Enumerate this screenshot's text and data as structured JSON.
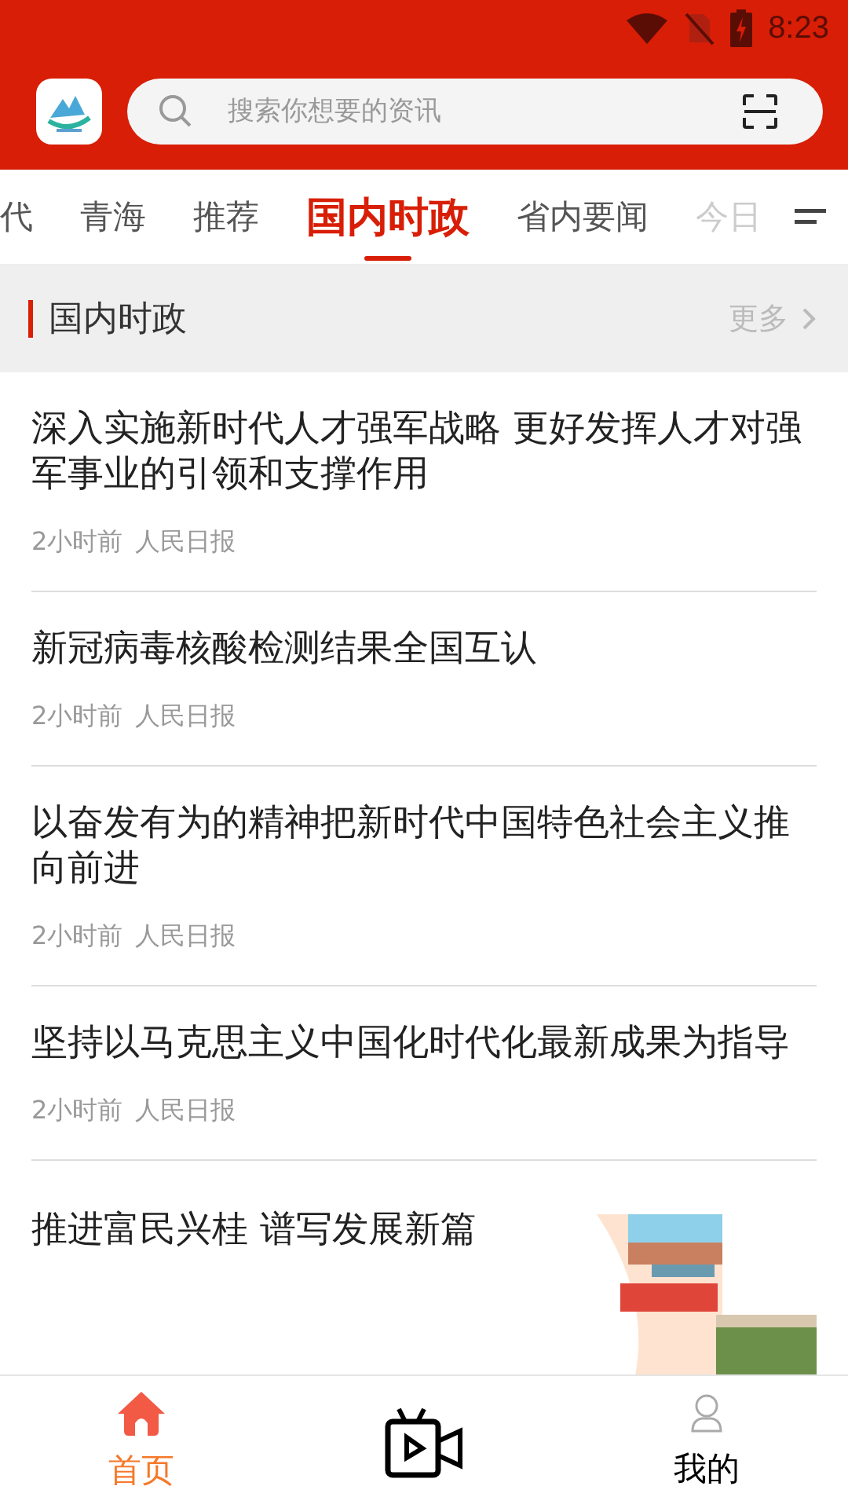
{
  "status_bar": {
    "time": "8:23"
  },
  "search": {
    "placeholder": "搜索你想要的资讯"
  },
  "tabs": [
    {
      "label": "代",
      "selected": false
    },
    {
      "label": "青海",
      "selected": false
    },
    {
      "label": "推荐",
      "selected": false
    },
    {
      "label": "国内时政",
      "selected": true
    },
    {
      "label": "省内要闻",
      "selected": false
    },
    {
      "label": "今日",
      "selected": false
    }
  ],
  "section": {
    "title": "国内时政",
    "more": "更多"
  },
  "articles": [
    {
      "title": "深入实施新时代人才强军战略  更好发挥人才对强军事业的引领和支撑作用",
      "time": "2小时前",
      "source": "人民日报"
    },
    {
      "title": "新冠病毒核酸检测结果全国互认",
      "time": "2小时前",
      "source": "人民日报"
    },
    {
      "title": "以奋发有为的精神把新时代中国特色社会主义推向前进",
      "time": "2小时前",
      "source": "人民日报"
    },
    {
      "title": "坚持以马克思主义中国化时代化最新成果为指导",
      "time": "2小时前",
      "source": "人民日报"
    },
    {
      "title": "推进富民兴桂    谱写发展新篇",
      "kind": "picture"
    }
  ],
  "bottom_nav": [
    {
      "kind": "home",
      "label": "首页",
      "selected": true
    },
    {
      "kind": "video",
      "selected": false
    },
    {
      "kind": "user",
      "label": "我的",
      "selected": false
    }
  ]
}
